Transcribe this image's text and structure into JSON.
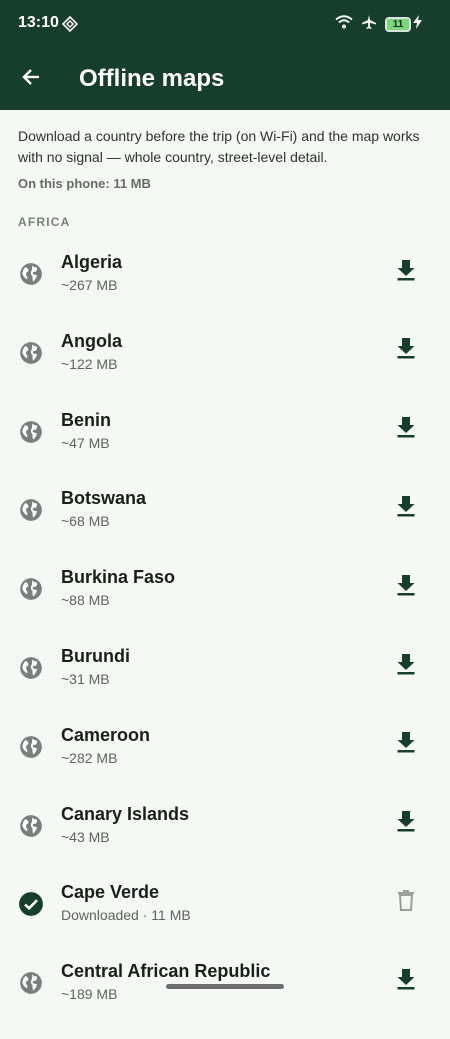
{
  "status_bar": {
    "time": "13:10",
    "battery": "11",
    "icons": [
      "diamond-icon",
      "wifi-icon",
      "airplane-icon",
      "battery-icon",
      "charging-bolt-icon"
    ]
  },
  "app_bar": {
    "title": "Offline maps",
    "back_icon": "arrow-back-icon"
  },
  "intro": {
    "text": "Download a country before the trip (on Wi-Fi) and the map works with no signal — whole country, street-level detail.",
    "usage": "On this phone: 11 MB"
  },
  "section_title": "AFRICA",
  "countries": [
    {
      "name": "Algeria",
      "detail": "~267 MB",
      "status": "available",
      "lead_icon": "globe-icon",
      "action_icon": "download-icon"
    },
    {
      "name": "Angola",
      "detail": "~122 MB",
      "status": "available",
      "lead_icon": "globe-icon",
      "action_icon": "download-icon"
    },
    {
      "name": "Benin",
      "detail": "~47 MB",
      "status": "available",
      "lead_icon": "globe-icon",
      "action_icon": "download-icon"
    },
    {
      "name": "Botswana",
      "detail": "~68 MB",
      "status": "available",
      "lead_icon": "globe-icon",
      "action_icon": "download-icon"
    },
    {
      "name": "Burkina Faso",
      "detail": "~88 MB",
      "status": "available",
      "lead_icon": "globe-icon",
      "action_icon": "download-icon"
    },
    {
      "name": "Burundi",
      "detail": "~31 MB",
      "status": "available",
      "lead_icon": "globe-icon",
      "action_icon": "download-icon"
    },
    {
      "name": "Cameroon",
      "detail": "~282 MB",
      "status": "available",
      "lead_icon": "globe-icon",
      "action_icon": "download-icon"
    },
    {
      "name": "Canary Islands",
      "detail": "~43 MB",
      "status": "available",
      "lead_icon": "globe-icon",
      "action_icon": "download-icon"
    },
    {
      "name": "Cape Verde",
      "detail": "Downloaded · 11 MB",
      "status": "downloaded",
      "lead_icon": "check-circle-icon",
      "action_icon": "delete-icon"
    },
    {
      "name": "Central African Republic",
      "detail": "~189 MB",
      "status": "available",
      "lead_icon": "globe-icon",
      "action_icon": "download-icon"
    }
  ],
  "colors": {
    "app_bar": "#173d2c",
    "background": "#f5f9f6",
    "download_icon": "#173d2c",
    "globe_icon": "#7b7f7c",
    "check_icon": "#173d2c",
    "delete_icon": "#9aa09c"
  }
}
